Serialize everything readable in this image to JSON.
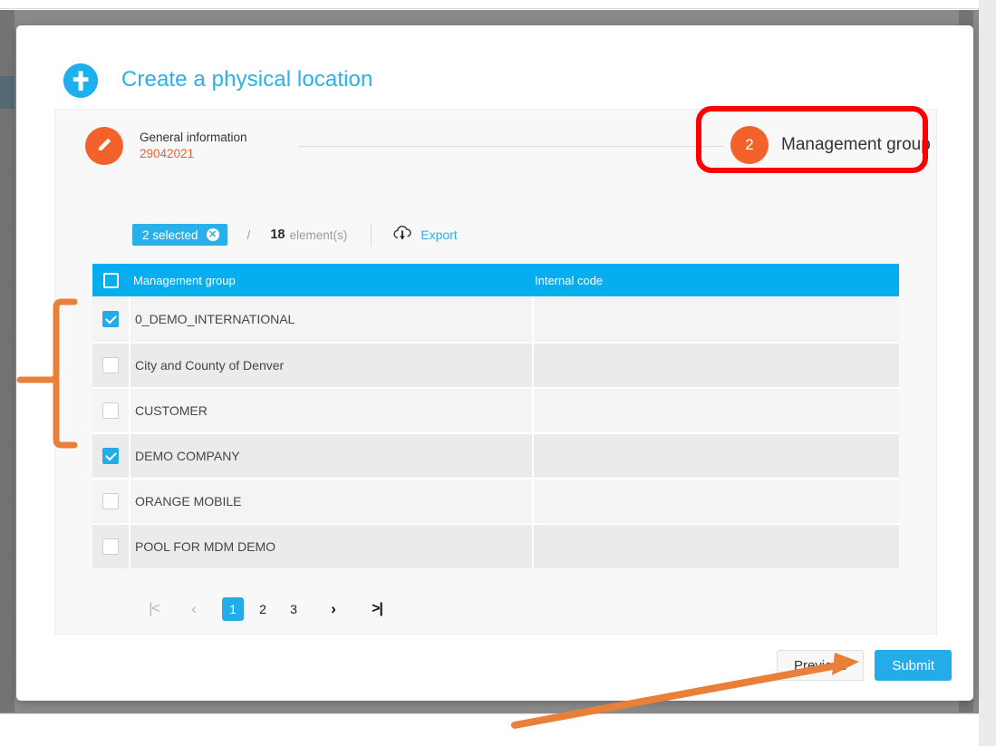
{
  "modal": {
    "title": "Create a physical location",
    "brand_icon": "location-pin-icon"
  },
  "stepper": {
    "step1": {
      "icon": "pencil-icon",
      "title": "General information",
      "subtitle": "29042021"
    },
    "step2": {
      "number": "2",
      "label": "Management group"
    }
  },
  "toolbar": {
    "selected_chip": "2 selected",
    "clear_icon": "clear-selection-icon",
    "separator": "/",
    "element_count": "18",
    "element_label": "element(s)",
    "export_icon": "cloud-download-icon",
    "export_label": "Export"
  },
  "table": {
    "header_checkbox_icon": "select-all-checkbox",
    "columns": [
      "Management group",
      "Internal code"
    ],
    "rows": [
      {
        "checked": true,
        "name": "0_DEMO_INTERNATIONAL",
        "code": ""
      },
      {
        "checked": false,
        "name": "City and County of Denver",
        "code": ""
      },
      {
        "checked": false,
        "name": "CUSTOMER",
        "code": ""
      },
      {
        "checked": true,
        "name": "DEMO COMPANY",
        "code": ""
      },
      {
        "checked": false,
        "name": "ORANGE MOBILE",
        "code": ""
      },
      {
        "checked": false,
        "name": "POOL FOR MDM DEMO",
        "code": ""
      }
    ]
  },
  "pagination": {
    "first_label": "|<",
    "prev_label": "‹",
    "pages": [
      "1",
      "2",
      "3"
    ],
    "active_page": "1",
    "next_label": "›",
    "last_label": ">|"
  },
  "footer": {
    "previous_label": "Previous",
    "submit_label": "Submit"
  },
  "annotations": {
    "highlight_box_color": "#ff0000",
    "bracket_color": "#e8803a",
    "arrow_color": "#e8803a"
  }
}
